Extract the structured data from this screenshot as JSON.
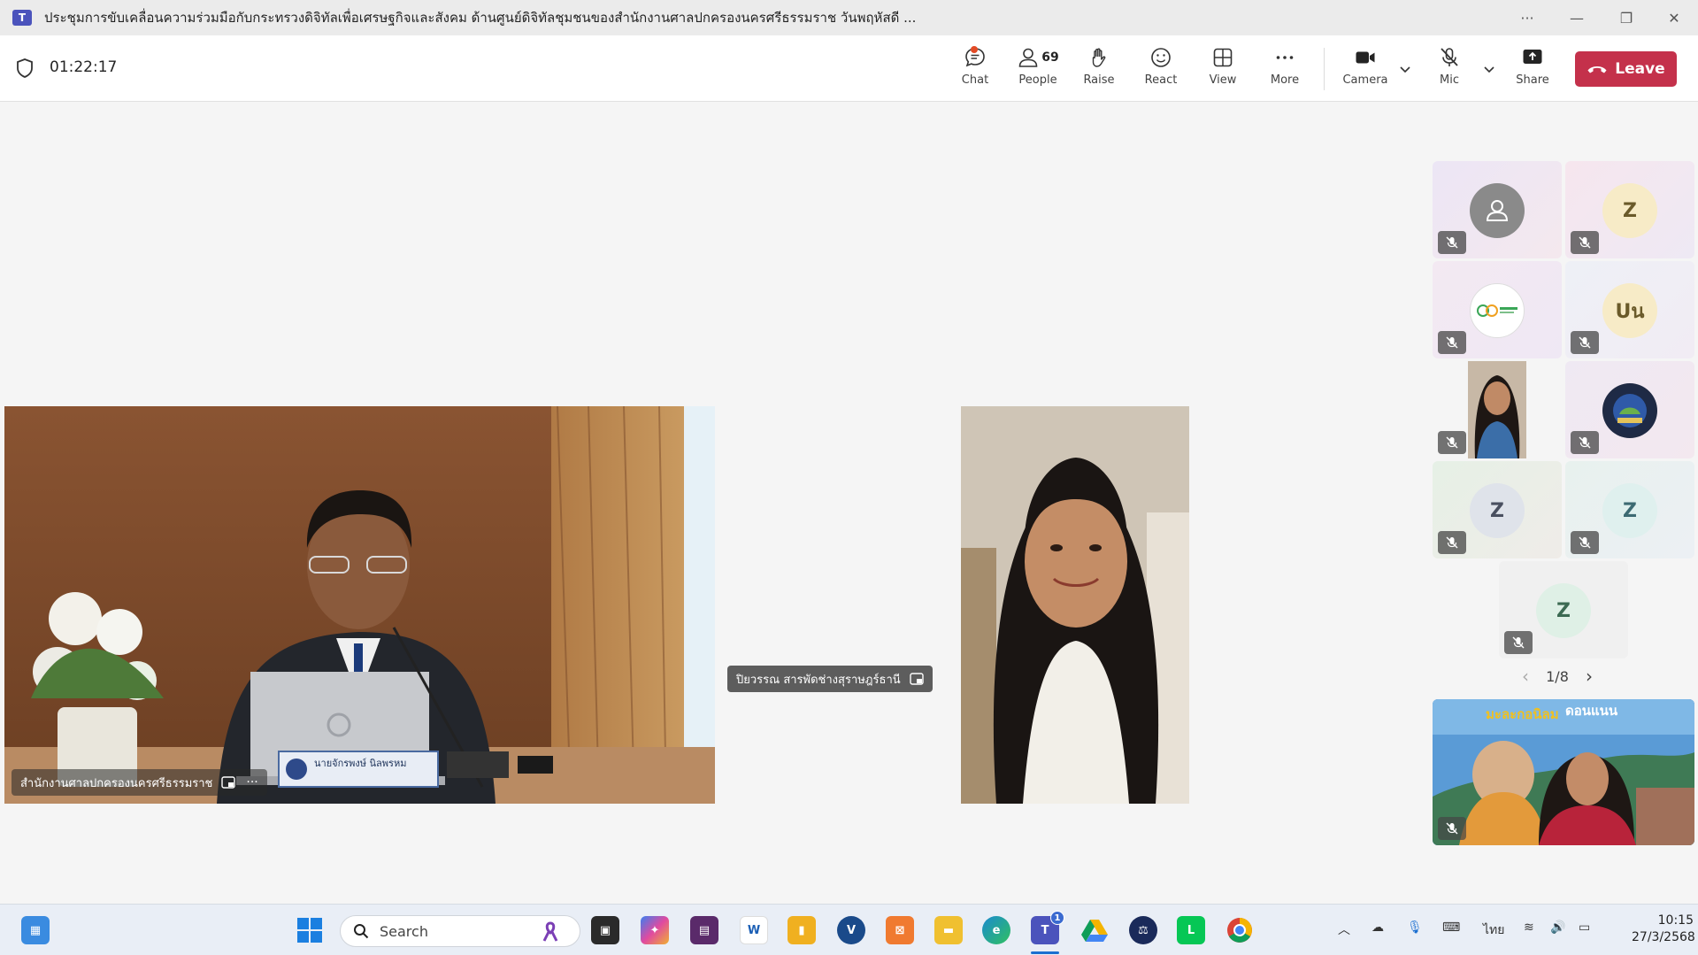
{
  "window": {
    "title": "ประชุมการขับเคลื่อนความร่วมมือกับกระทรวงดิจิทัลเพื่อเศรษฐกิจและสังคม ด้านศูนย์ดิจิทัลชุมชนของสำนักงานศาลปกครองนครศรีธรรมราช วันพฤหัสดี ...",
    "more_glyph": "···",
    "minimize_glyph": "—",
    "restore_glyph": "❐",
    "close_glyph": "✕"
  },
  "toolbar": {
    "elapsed": "01:22:17",
    "chat_label": "Chat",
    "people_label": "People",
    "people_count": "69",
    "raise_label": "Raise",
    "react_label": "React",
    "view_label": "View",
    "more_label": "More",
    "camera_label": "Camera",
    "mic_label": "Mic",
    "share_label": "Share",
    "leave_label": "Leave"
  },
  "stage": {
    "main_speaker_name": "สำนักงานศาลปกครองนครศรีธรรมราช",
    "main_more": "···",
    "second_speaker_name": "ปิยวรรณ สารพัดช่างสุราษฎร์ธานี",
    "desk_nameplate": "นายจักรพงษ์ นิลพรหม"
  },
  "participants": [
    {
      "initials": "",
      "kind": "generic",
      "bg": "#ece6f5"
    },
    {
      "initials": "Z",
      "kind": "letter",
      "bg": "#f6e6ee",
      "avatar_bg": "#f7ebc7"
    },
    {
      "initials": "",
      "kind": "logo",
      "bg": "#f3e9f2"
    },
    {
      "initials": "Uน",
      "kind": "letter",
      "bg": "#eef0f6",
      "avatar_bg": "#f7ebc7"
    },
    {
      "initials": "",
      "kind": "photo",
      "bg": "#f0f0f0"
    },
    {
      "initials": "",
      "kind": "emblem",
      "bg": "#efe9f3"
    },
    {
      "initials": "Z",
      "kind": "letter",
      "bg": "#e6f0e6",
      "avatar_bg": "#dfe3ea"
    },
    {
      "initials": "Z",
      "kind": "letter",
      "bg": "#e8f1ee",
      "avatar_bg": "#dff0ee"
    },
    {
      "initials": "Z",
      "kind": "letter",
      "bg": "#f0f0f0",
      "avatar_bg": "#dff0e6"
    }
  ],
  "pager": {
    "text": "1/8",
    "prev": "‹",
    "next": "›"
  },
  "self_view": {
    "banner_left": "มะละกอนิลม",
    "banner_right": "ดอนแนน"
  },
  "taskbar": {
    "search_placeholder": "Search",
    "teams_badge": "1",
    "language": "ไทย",
    "time": "10:15",
    "date": "27/3/2568"
  },
  "colors": {
    "leave": "#c4314b",
    "teams": "#4b53bc",
    "chat_dot": "#e24b26"
  }
}
